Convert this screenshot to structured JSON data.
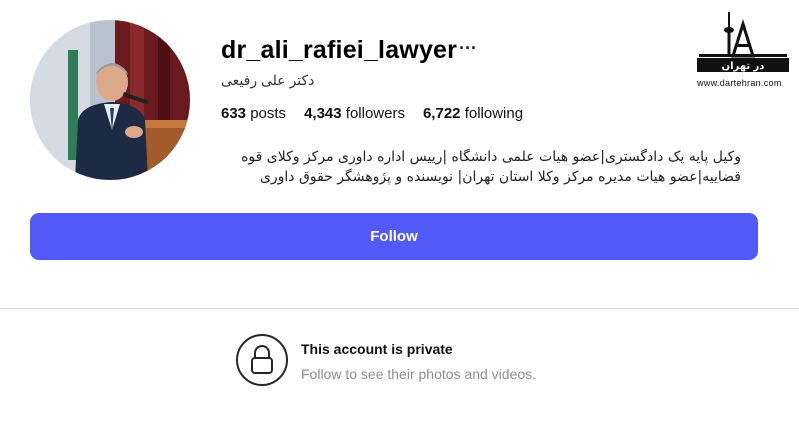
{
  "profile": {
    "username": "dr_ali_rafiei_lawyer",
    "more_label": "···",
    "full_name": "دکتر علی رفیعی",
    "stats": {
      "posts_count": "633",
      "posts_label": "posts",
      "followers_count": "4,343",
      "followers_label": "followers",
      "following_count": "6,722",
      "following_label": "following"
    },
    "bio_line_1": "وکیل پایه یک دادگستری|عضو هیات علمی دانشگاه |رییس اداره داوری مرکز وکلای قوه",
    "bio_line_2": "قضاییه|عضو هیات مدیره مرکز وکلا استان تهران| نویسنده و پژوهشگر حقوق داوری"
  },
  "actions": {
    "follow_label": "Follow"
  },
  "private_notice": {
    "title": "This account is private",
    "subtitle": "Follow to see their photos and videos."
  },
  "watermark": {
    "logo_text": "در تهران",
    "url": "www.dartehran.com"
  },
  "colors": {
    "follow_button": "#5159f6",
    "background": "#ffffff",
    "subtle_text": "#8e8e8e"
  },
  "icons": {
    "lock": "lock-icon",
    "more": "more-options-icon"
  }
}
